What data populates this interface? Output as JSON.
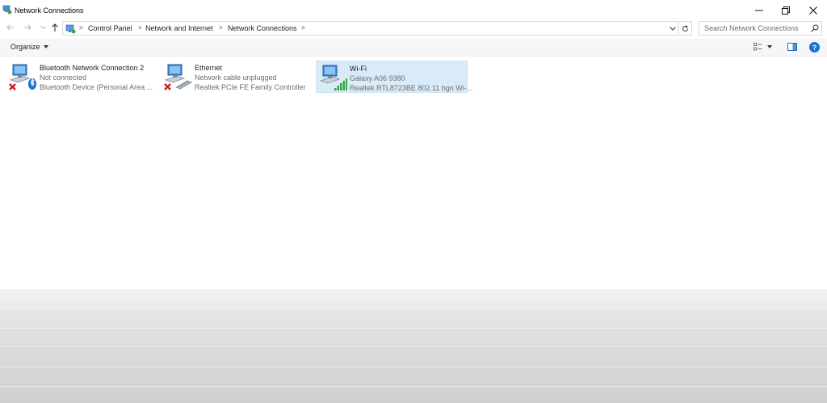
{
  "window": {
    "title": "Network Connections",
    "controls": {
      "minimize": "—",
      "restore": "❐",
      "close": "✕"
    }
  },
  "address_bar": {
    "breadcrumbs": [
      "Control Panel",
      "Network and Internet",
      "Network Connections"
    ],
    "separator": ">",
    "search_placeholder": "Search Network Connections"
  },
  "command_bar": {
    "organize_label": "Organize"
  },
  "connections": [
    {
      "name": "Bluetooth Network Connection 2",
      "status": "Not connected",
      "device": "Bluetooth Device (Personal Area ...",
      "icon": "bluetooth-network-icon",
      "disabled_mark": true,
      "selected": false
    },
    {
      "name": "Ethernet",
      "status": "Network cable unplugged",
      "device": "Realtek PCIe FE Family Controller",
      "icon": "ethernet-network-icon",
      "disabled_mark": true,
      "selected": false
    },
    {
      "name": "Wi-Fi",
      "status": "Galaxy A06 9380",
      "device": "Realtek RTL8723BE 802.11 bgn Wi-...",
      "icon": "wifi-network-icon",
      "disabled_mark": false,
      "selected": true
    }
  ],
  "colors": {
    "selection": "#d9ebf9",
    "help_blue": "#1a6fd3",
    "error_red": "#d01c1c",
    "signal_green": "#3aa843"
  }
}
